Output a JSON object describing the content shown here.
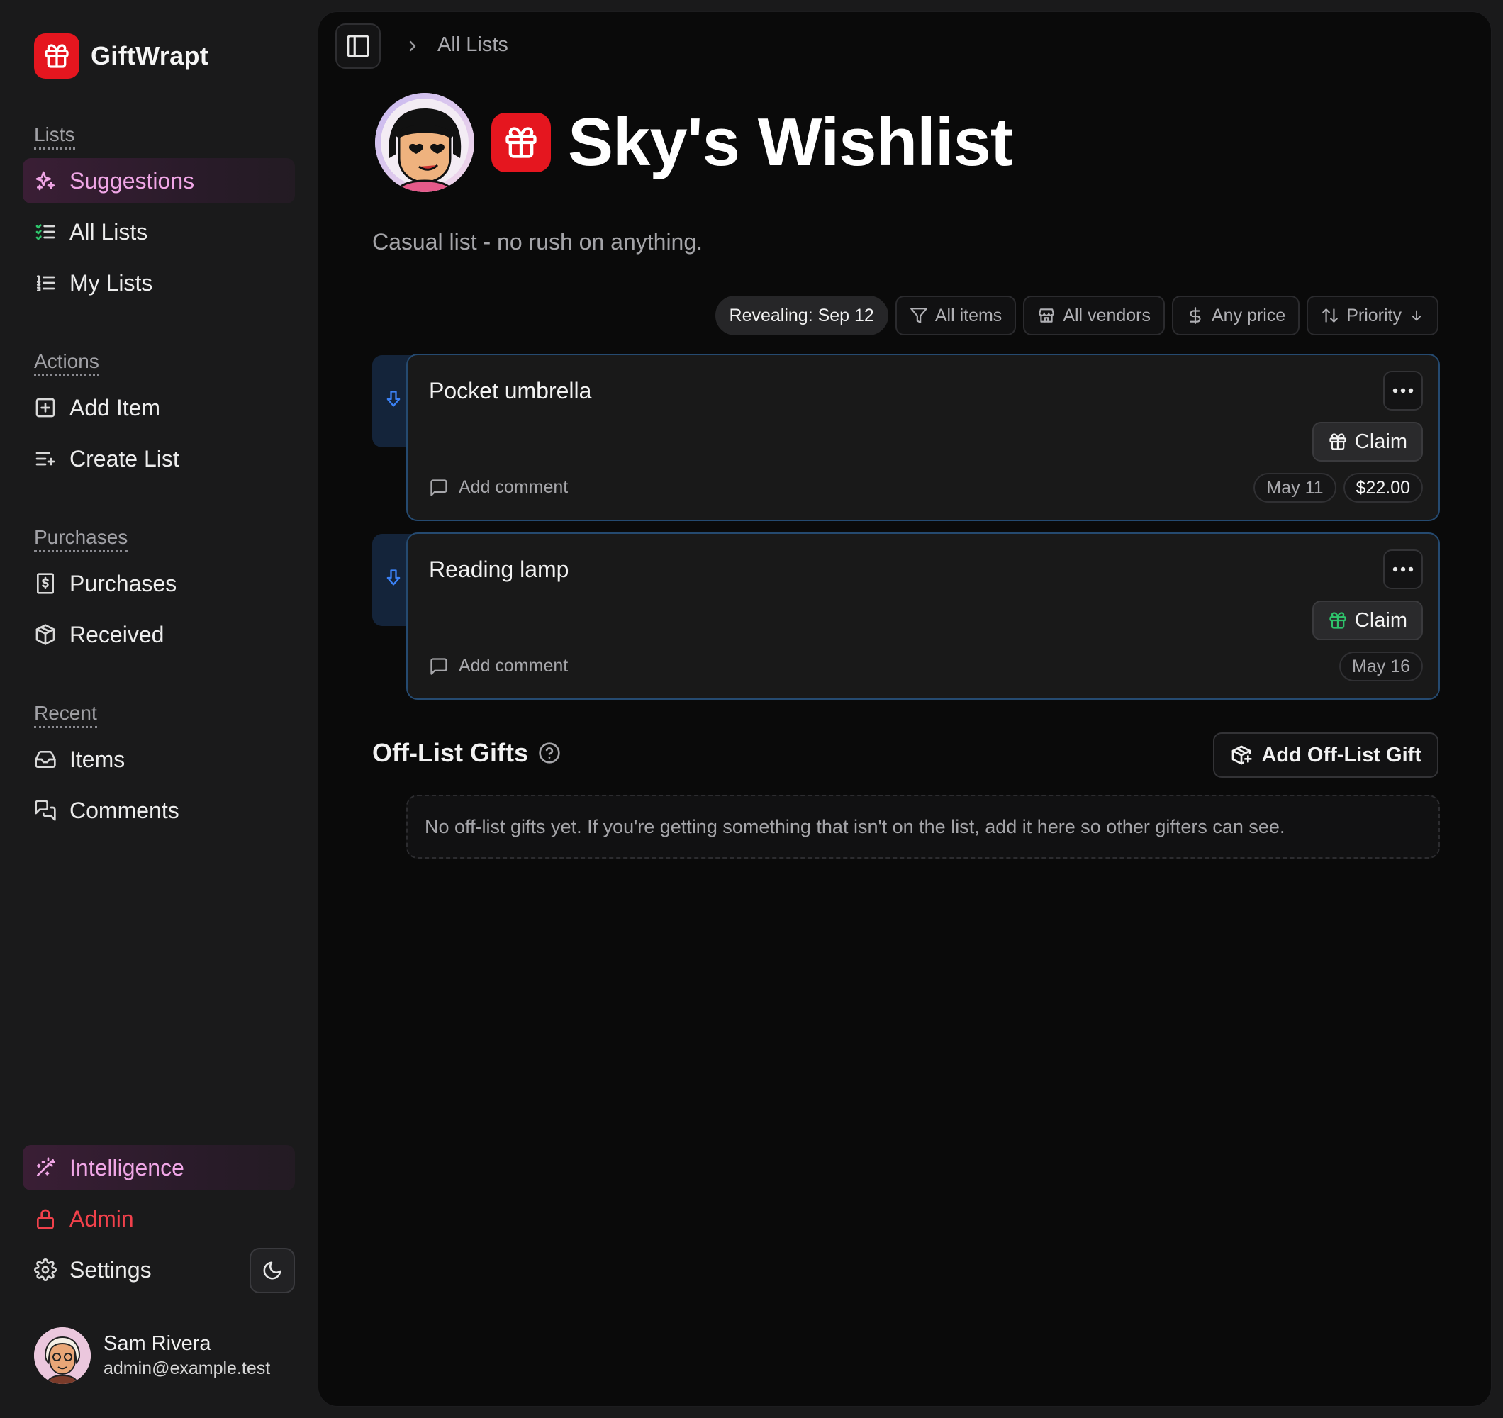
{
  "app": {
    "name": "GiftWrapt",
    "brand_color": "#e5161f",
    "accent_color": "#f0a6e6"
  },
  "sidebar": {
    "sections": [
      {
        "label": "Lists",
        "items": [
          {
            "label": "Suggestions",
            "icon": "sparkles-icon",
            "active": true
          },
          {
            "label": "All Lists",
            "icon": "list-checks-icon"
          },
          {
            "label": "My Lists",
            "icon": "list-ordered-icon"
          }
        ]
      },
      {
        "label": "Actions",
        "items": [
          {
            "label": "Add Item",
            "icon": "square-plus-icon"
          },
          {
            "label": "Create List",
            "icon": "list-plus-icon"
          }
        ]
      },
      {
        "label": "Purchases",
        "items": [
          {
            "label": "Purchases",
            "icon": "receipt-icon"
          },
          {
            "label": "Received",
            "icon": "package-icon"
          }
        ]
      },
      {
        "label": "Recent",
        "items": [
          {
            "label": "Items",
            "icon": "inbox-icon"
          },
          {
            "label": "Comments",
            "icon": "messages-icon"
          }
        ]
      }
    ],
    "footer_items": [
      {
        "label": "Intelligence",
        "icon": "wand-icon",
        "active": true
      },
      {
        "label": "Admin",
        "icon": "lock-icon",
        "color": "#f0414b"
      },
      {
        "label": "Settings",
        "icon": "gear-icon"
      }
    ],
    "theme_toggle_icon": "moon-icon",
    "user": {
      "name": "Sam Rivera",
      "email": "admin@example.test"
    }
  },
  "breadcrumb": {
    "current": "All Lists"
  },
  "list": {
    "title": "Sky's Wishlist",
    "description": "Casual list - no rush on anything."
  },
  "filters": {
    "reveal": "Revealing: Sep 12",
    "items": "All items",
    "vendors": "All vendors",
    "price": "Any price",
    "sort": "Priority"
  },
  "items": [
    {
      "title": "Pocket umbrella",
      "claim_label": "Claim",
      "comment_label": "Add comment",
      "date": "May 11",
      "price": "$22.00"
    },
    {
      "title": "Reading lamp",
      "claim_label": "Claim",
      "comment_label": "Add comment",
      "date": "May 16",
      "claim_icon_color": "#2ec46b"
    }
  ],
  "offlist": {
    "title": "Off-List Gifts",
    "add_label": "Add Off-List Gift",
    "empty_text": "No off-list gifts yet. If you're getting something that isn't on the list, add it here so other gifters can see."
  }
}
